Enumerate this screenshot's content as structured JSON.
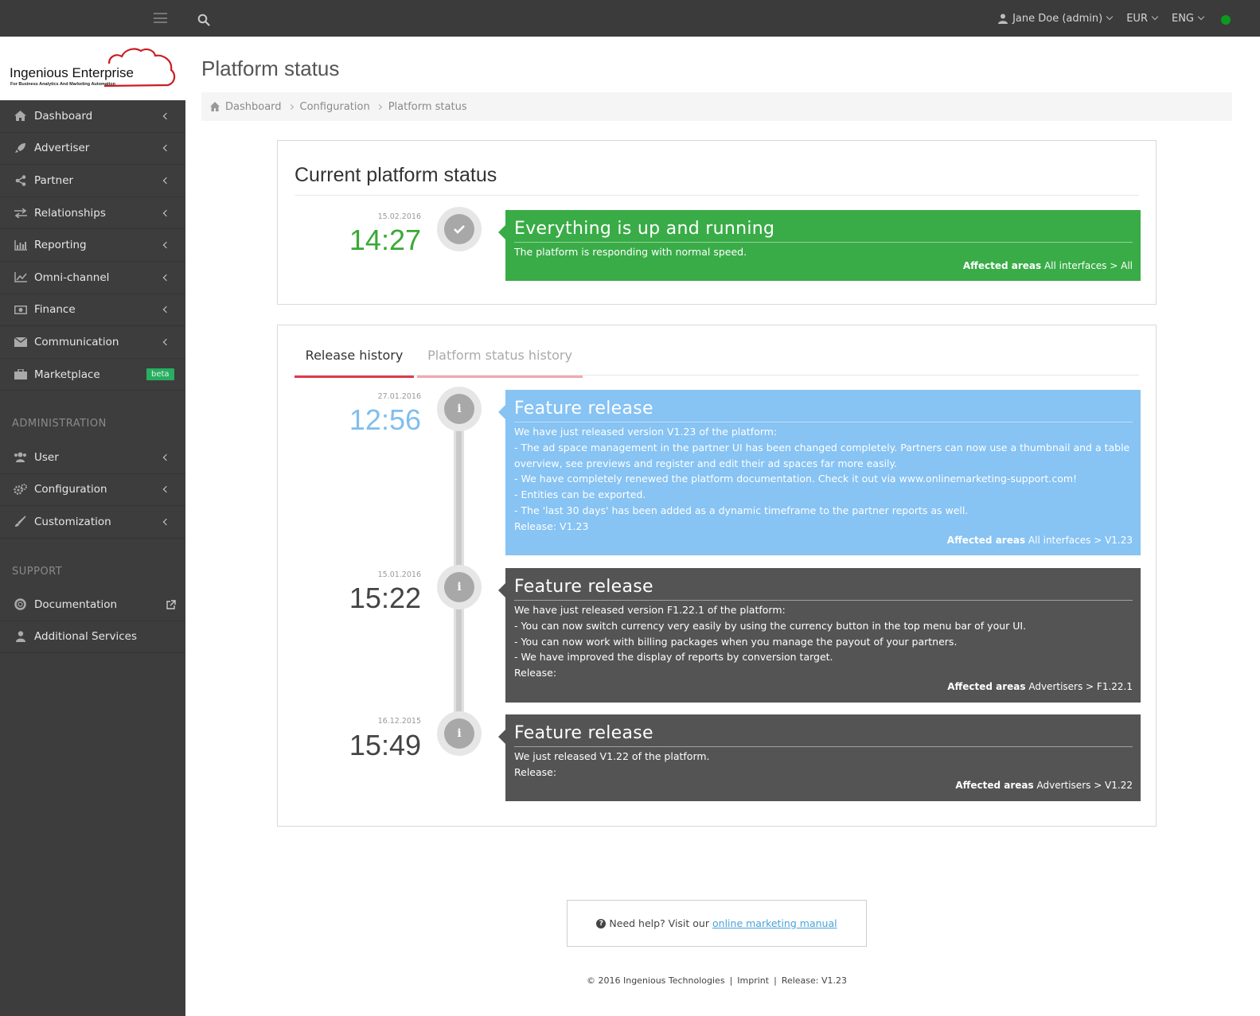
{
  "topbar": {
    "user": "Jane Doe (admin)",
    "currency": "EUR",
    "language": "ENG",
    "status_color": "#0a9b1f"
  },
  "logo": {
    "title_a": "Ingenious",
    "title_b": "Enterprise",
    "subtitle": "For Business Analytics And Marketing Automation",
    "accent": "#cc1b22"
  },
  "sidebar": {
    "items": [
      {
        "label": "Dashboard",
        "icon": "dashboard-icon"
      },
      {
        "label": "Advertiser",
        "icon": "rocket-icon"
      },
      {
        "label": "Partner",
        "icon": "share-icon"
      },
      {
        "label": "Relationships",
        "icon": "exchange-icon"
      },
      {
        "label": "Reporting",
        "icon": "bar-chart-icon"
      },
      {
        "label": "Omni-channel",
        "icon": "line-chart-icon"
      },
      {
        "label": "Finance",
        "icon": "money-icon"
      },
      {
        "label": "Communication",
        "icon": "envelope-icon"
      },
      {
        "label": "Marketplace",
        "icon": "briefcase-icon",
        "badge": "beta"
      }
    ],
    "admin_title": "ADMINISTRATION",
    "admin_items": [
      {
        "label": "User",
        "icon": "users-icon"
      },
      {
        "label": "Configuration",
        "icon": "cogs-icon"
      },
      {
        "label": "Customization",
        "icon": "brush-icon"
      }
    ],
    "support_title": "SUPPORT",
    "support_items": [
      {
        "label": "Documentation",
        "icon": "lifebuoy-icon"
      },
      {
        "label": "Additional Services",
        "icon": "user-icon"
      }
    ]
  },
  "page": {
    "title": "Platform status",
    "breadcrumb": [
      "Dashboard",
      "Configuration",
      "Platform status"
    ]
  },
  "current": {
    "heading": "Current platform status",
    "date": "15.02.2016",
    "time": "14:27",
    "time_color": "#3aa935",
    "card_title": "Everything is up and running",
    "card_body": "The platform is responding with normal speed.",
    "affected_label": "Affected areas",
    "affected_value": "All interfaces > All",
    "card_color": "#39ac47"
  },
  "tabs": {
    "active": "Release history",
    "inactive": "Platform status history"
  },
  "releases": [
    {
      "date": "27.01.2016",
      "time": "12:56",
      "time_color": "#7fbfed",
      "title": "Feature release",
      "color": "#87c3f3",
      "lines": [
        "We have just released version V1.23 of the platform:",
        "- The ad space management in the partner UI has been changed completely. Partners can now use a thumbnail and a table",
        "overview, see previews and register and edit their ad spaces far more easily.",
        "- We have completely renewed the platform documentation. Check it out via www.onlinemarketing-support.com!",
        "- Entities can be exported.",
        "- The 'last 30 days' has been added as a dynamic timeframe to the partner reports as well.",
        "Release: V1.23"
      ],
      "affected_label": "Affected areas",
      "affected_value": "All interfaces > V1.23"
    },
    {
      "date": "15.01.2016",
      "time": "15:22",
      "time_color": "#444444",
      "title": "Feature release",
      "color": "#545454",
      "lines": [
        "We have just released version F1.22.1 of the platform:",
        "- You can now switch currency very easily by using the currency button in the top menu bar of your UI.",
        "- You can now work with billing packages when you manage the payout of your partners.",
        "- We have improved the display of reports by conversion target.",
        "Release:"
      ],
      "affected_label": "Affected areas",
      "affected_value": "Advertisers > F1.22.1"
    },
    {
      "date": "16.12.2015",
      "time": "15:49",
      "time_color": "#444444",
      "title": "Feature release",
      "color": "#545454",
      "lines": [
        "We just released V1.22 of the platform.",
        "Release:"
      ],
      "affected_label": "Affected areas",
      "affected_value": "Advertisers > V1.22"
    }
  ],
  "help": {
    "text": "Need help? Visit our",
    "link": "online marketing manual"
  },
  "footer": {
    "copyright": "© 2016 Ingenious Technologies",
    "imprint": "Imprint",
    "release": "Release: V1.23"
  }
}
